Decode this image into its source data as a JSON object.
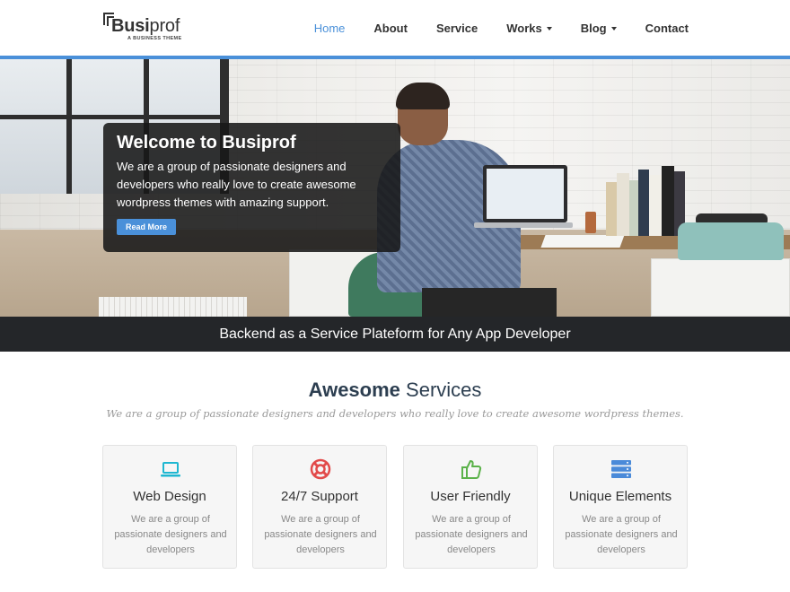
{
  "brand": {
    "name_bold": "Busi",
    "name_regular": "prof",
    "tagline": "A BUSINESS THEME"
  },
  "nav": {
    "items": [
      {
        "label": "Home",
        "active": true,
        "dropdown": false
      },
      {
        "label": "About",
        "active": false,
        "dropdown": false
      },
      {
        "label": "Service",
        "active": false,
        "dropdown": false
      },
      {
        "label": "Works",
        "active": false,
        "dropdown": true
      },
      {
        "label": "Blog",
        "active": false,
        "dropdown": true
      },
      {
        "label": "Contact",
        "active": false,
        "dropdown": false
      }
    ]
  },
  "hero": {
    "title": "Welcome to Busiprof",
    "text": "We are a group of passionate designers and developers who really love to create awesome wordpress themes with amazing support.",
    "button": "Read More"
  },
  "strip": {
    "text": "Backend as a Service Plateform for Any App Developer"
  },
  "services": {
    "title_bold": "Awesome",
    "title_regular": "Services",
    "subtitle": "We are a group of passionate designers and developers who really love to create awesome wordpress themes.",
    "cards": [
      {
        "title": "Web Design",
        "text": "We are a group of passionate designers and developers",
        "icon": "laptop-icon",
        "color": "#1eb7d1"
      },
      {
        "title": "24/7 Support",
        "text": "We are a group of passionate designers and developers",
        "icon": "life-ring-icon",
        "color": "#e24a4a"
      },
      {
        "title": "User Friendly",
        "text": "We are a group of passionate designers and developers",
        "icon": "thumbs-up-icon",
        "color": "#5bb24a"
      },
      {
        "title": "Unique Elements",
        "text": "We are a group of passionate designers and developers",
        "icon": "server-icon",
        "color": "#4a8ad9"
      }
    ]
  },
  "colors": {
    "accent": "#4a90d9",
    "dark": "#242629"
  }
}
